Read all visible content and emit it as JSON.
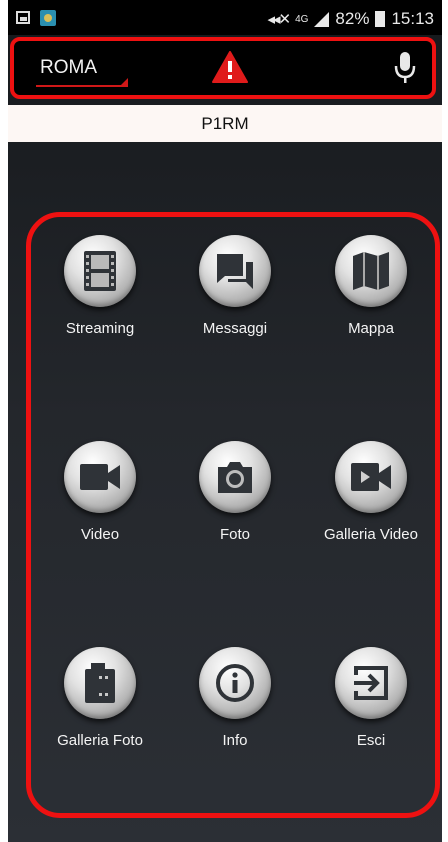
{
  "status_bar": {
    "signal_type": "4G",
    "battery": "82%",
    "time": "15:13",
    "icons": [
      "gallery-thumbnail-icon",
      "app-notification-icon",
      "mute-icon",
      "signal-icon",
      "battery-icon"
    ]
  },
  "header": {
    "city": "ROMA",
    "warning_icon": "warning-icon",
    "mic_icon": "microphone-icon"
  },
  "subtitle": "P1RM",
  "menu": {
    "items": [
      {
        "label": "Streaming",
        "icon": "film-strip-icon"
      },
      {
        "label": "Messaggi",
        "icon": "chat-bubbles-icon"
      },
      {
        "label": "Mappa",
        "icon": "map-icon"
      },
      {
        "label": "Video",
        "icon": "video-camera-icon"
      },
      {
        "label": "Foto",
        "icon": "photo-camera-icon"
      },
      {
        "label": "Galleria Video",
        "icon": "video-gallery-icon"
      },
      {
        "label": "Galleria Foto",
        "icon": "photo-film-icon"
      },
      {
        "label": "Info",
        "icon": "info-icon"
      },
      {
        "label": "Esci",
        "icon": "exit-icon"
      }
    ]
  },
  "colors": {
    "highlight": "#ee1111",
    "warning": "#e01b1b",
    "background_top": "#16191c",
    "background_bottom": "#2b2f35",
    "subtitle_bg": "#fdf7f4"
  }
}
